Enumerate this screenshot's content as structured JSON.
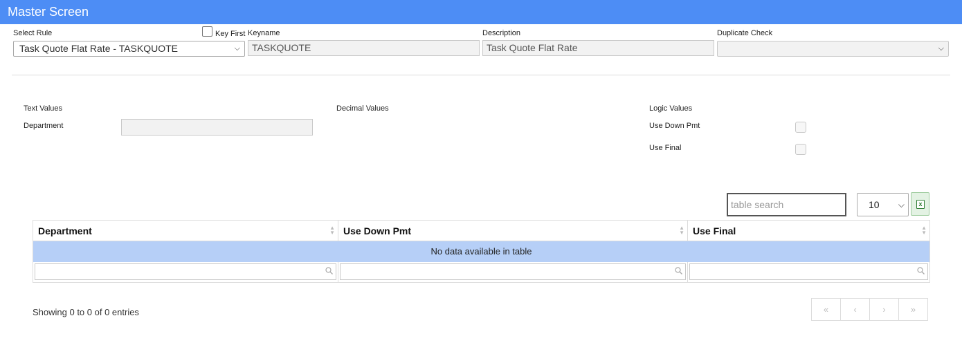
{
  "window": {
    "title": "Master Screen"
  },
  "header": {
    "select_rule_label": "Select Rule",
    "select_rule_value": "Task Quote Flat Rate - TASKQUOTE",
    "key_first_label": "Key First",
    "keyname_label": "Keyname",
    "keyname_value": "TASKQUOTE",
    "description_label": "Description",
    "description_value": "Task Quote Flat Rate",
    "duplicate_check_label": "Duplicate Check",
    "duplicate_check_value": ""
  },
  "values": {
    "text_values_label": "Text Values",
    "department_label": "Department",
    "department_value": "",
    "decimal_values_label": "Decimal Values",
    "logic_values_label": "Logic Values",
    "use_down_pmt_label": "Use Down Pmt",
    "use_final_label": "Use Final"
  },
  "table": {
    "search_placeholder": "table search",
    "page_length": "10",
    "excel_icon": "excel-export-icon",
    "columns": [
      "Department",
      "Use Down Pmt",
      "Use Final"
    ],
    "empty_message": "No data available in table",
    "info": "Showing 0 to 0 of 0 entries",
    "pager": [
      "«",
      "‹",
      "›",
      "»"
    ]
  },
  "colors": {
    "titlebar": "#4d8df5",
    "empty_row": "#b6cff7",
    "excel": "#2e7d32"
  }
}
